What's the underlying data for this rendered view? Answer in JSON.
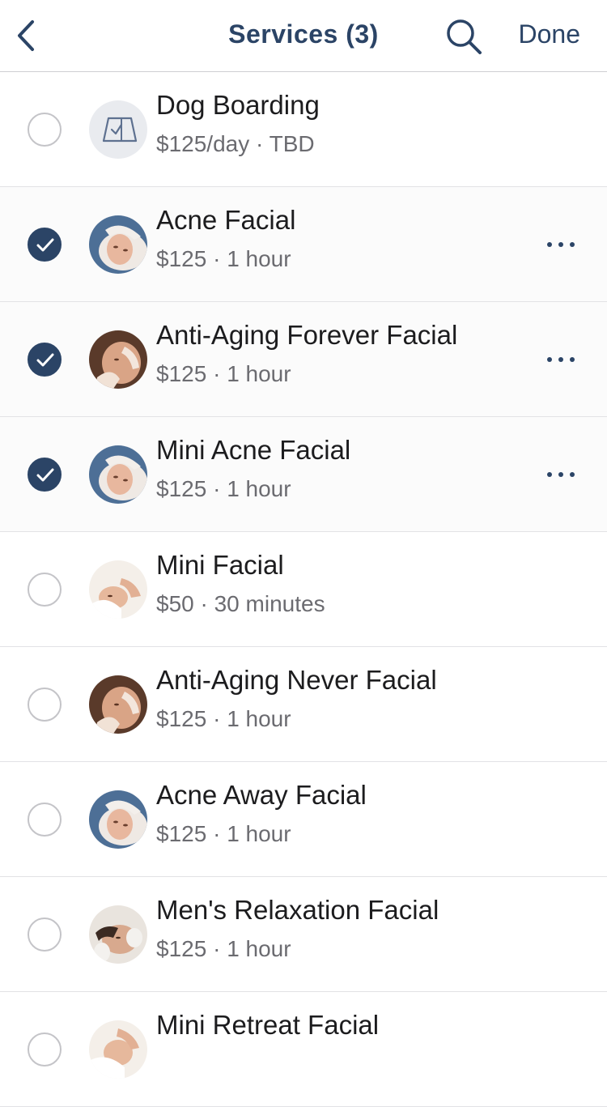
{
  "header": {
    "title": "Services (3)",
    "done_label": "Done"
  },
  "colors": {
    "accent": "#2b4466",
    "divider": "#e2e2e5",
    "secondary_text": "#6b6b70"
  },
  "services": [
    {
      "name": "Dog Boarding",
      "price": "$125/day",
      "duration": "TBD",
      "selected": false,
      "icon": "checklist-icon",
      "has_menu": false
    },
    {
      "name": "Acne Facial",
      "price": "$125",
      "duration": "1 hour",
      "selected": true,
      "icon": "facial-photo",
      "has_menu": true
    },
    {
      "name": "Anti-Aging Forever Facial",
      "price": "$125",
      "duration": "1 hour",
      "selected": true,
      "icon": "facial-photo",
      "has_menu": true
    },
    {
      "name": "Mini Acne Facial",
      "price": "$125",
      "duration": "1 hour",
      "selected": true,
      "icon": "facial-photo",
      "has_menu": true
    },
    {
      "name": "Mini Facial",
      "price": "$50",
      "duration": "30 minutes",
      "selected": false,
      "icon": "facial-photo",
      "has_menu": false
    },
    {
      "name": "Anti-Aging Never Facial",
      "price": "$125",
      "duration": "1 hour",
      "selected": false,
      "icon": "facial-photo",
      "has_menu": false
    },
    {
      "name": "Acne Away Facial",
      "price": "$125",
      "duration": "1 hour",
      "selected": false,
      "icon": "facial-photo",
      "has_menu": false
    },
    {
      "name": "Men's Relaxation Facial",
      "price": "$125",
      "duration": "1 hour",
      "selected": false,
      "icon": "facial-photo",
      "has_menu": false
    },
    {
      "name": "Mini Retreat Facial",
      "price": "",
      "duration": "",
      "selected": false,
      "icon": "facial-photo",
      "has_menu": false
    }
  ]
}
